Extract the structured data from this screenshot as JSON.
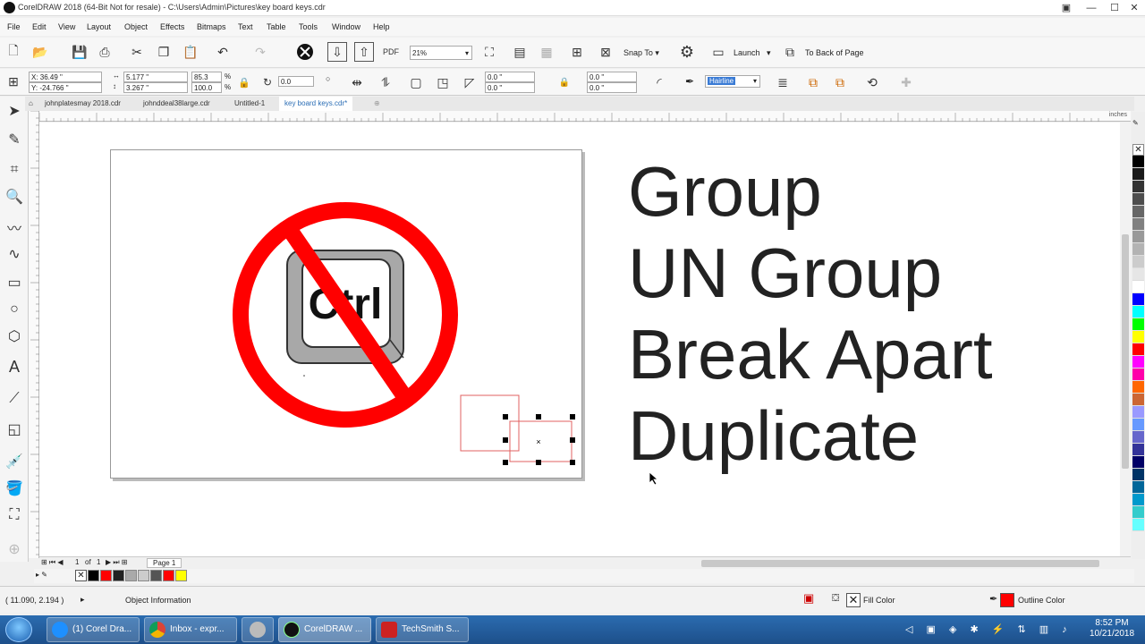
{
  "window": {
    "title": "CorelDRAW 2018 (64-Bit Not for resale) - C:\\Users\\Admin\\Pictures\\key board keys.cdr"
  },
  "menu": [
    "File",
    "Edit",
    "View",
    "Layout",
    "Object",
    "Effects",
    "Bitmaps",
    "Text",
    "Table",
    "Tools",
    "Window",
    "Help"
  ],
  "toolbar": {
    "zoom": "21%",
    "snap_to": "Snap To",
    "launch": "Launch",
    "to_back": "To Back of Page",
    "pdf_label": "PDF"
  },
  "property_bar": {
    "x": "X: 36.49 \"",
    "y": "Y: -24.766 \"",
    "width": "5.177 \"",
    "height": "3.267 \"",
    "scale_w": "85.3",
    "scale_h": "100.0",
    "pct": "%",
    "rotation": "0.0",
    "corner1": "0.0 \"",
    "corner2": "0.0 \"",
    "corner3": "0.0 \"",
    "corner4": "0.0 \"",
    "outline": "Hairline"
  },
  "tabs": [
    {
      "label": "johnplatesmay 2018.cdr",
      "active": false
    },
    {
      "label": "johnddeal38large.cdr",
      "active": false
    },
    {
      "label": "Untitled-1",
      "active": false
    },
    {
      "label": "key board keys.cdr*",
      "active": true
    }
  ],
  "ruler": {
    "unit": "inches"
  },
  "artwork": {
    "key_label": "Ctrl",
    "lines": [
      "Group",
      "UN Group",
      "Break Apart",
      "Duplicate"
    ],
    "prohibition_color": "#ff0000"
  },
  "page_nav": {
    "current": "1",
    "of": "of",
    "total": "1",
    "page_tab": "Page 1"
  },
  "status": {
    "coords": "( 11.090, 2.194 )",
    "object_info": "Object Information",
    "fill_label": "Fill Color",
    "outline_label": "Outline Color",
    "outline_color": "#ff0000"
  },
  "taskbar": {
    "items": [
      {
        "label": "(1) Corel Dra...",
        "color": "#1e90ff",
        "active": false
      },
      {
        "label": "Inbox - expr...",
        "color": "#e8b21c",
        "active": false
      },
      {
        "label": "",
        "color": "#999999",
        "active": false
      },
      {
        "label": "CorelDRAW ...",
        "color": "#111111",
        "active": true
      },
      {
        "label": "TechSmith S...",
        "color": "#cc2222",
        "active": false
      }
    ],
    "time": "8:52 PM",
    "date": "10/21/2018"
  },
  "palette_colors": [
    "#000000",
    "#1a1a1a",
    "#333333",
    "#4d4d4d",
    "#666666",
    "#808080",
    "#999999",
    "#b3b3b3",
    "#cccccc",
    "#e6e6e6",
    "#ffffff",
    "#0000ff",
    "#00ffff",
    "#00ff00",
    "#ffff00",
    "#ff0000",
    "#ff00ff",
    "#ff00aa",
    "#ff6600",
    "#cc6633",
    "#9999ff",
    "#6699ff",
    "#6666cc",
    "#333399",
    "#000066",
    "#003366",
    "#006699",
    "#0099cc",
    "#33cccc",
    "#66ffff"
  ],
  "doc_palette": [
    "#000000",
    "#ff0000",
    "#222222",
    "#aaaaaa",
    "#cccccc",
    "#555555",
    "#ff0000",
    "#ffff00"
  ]
}
